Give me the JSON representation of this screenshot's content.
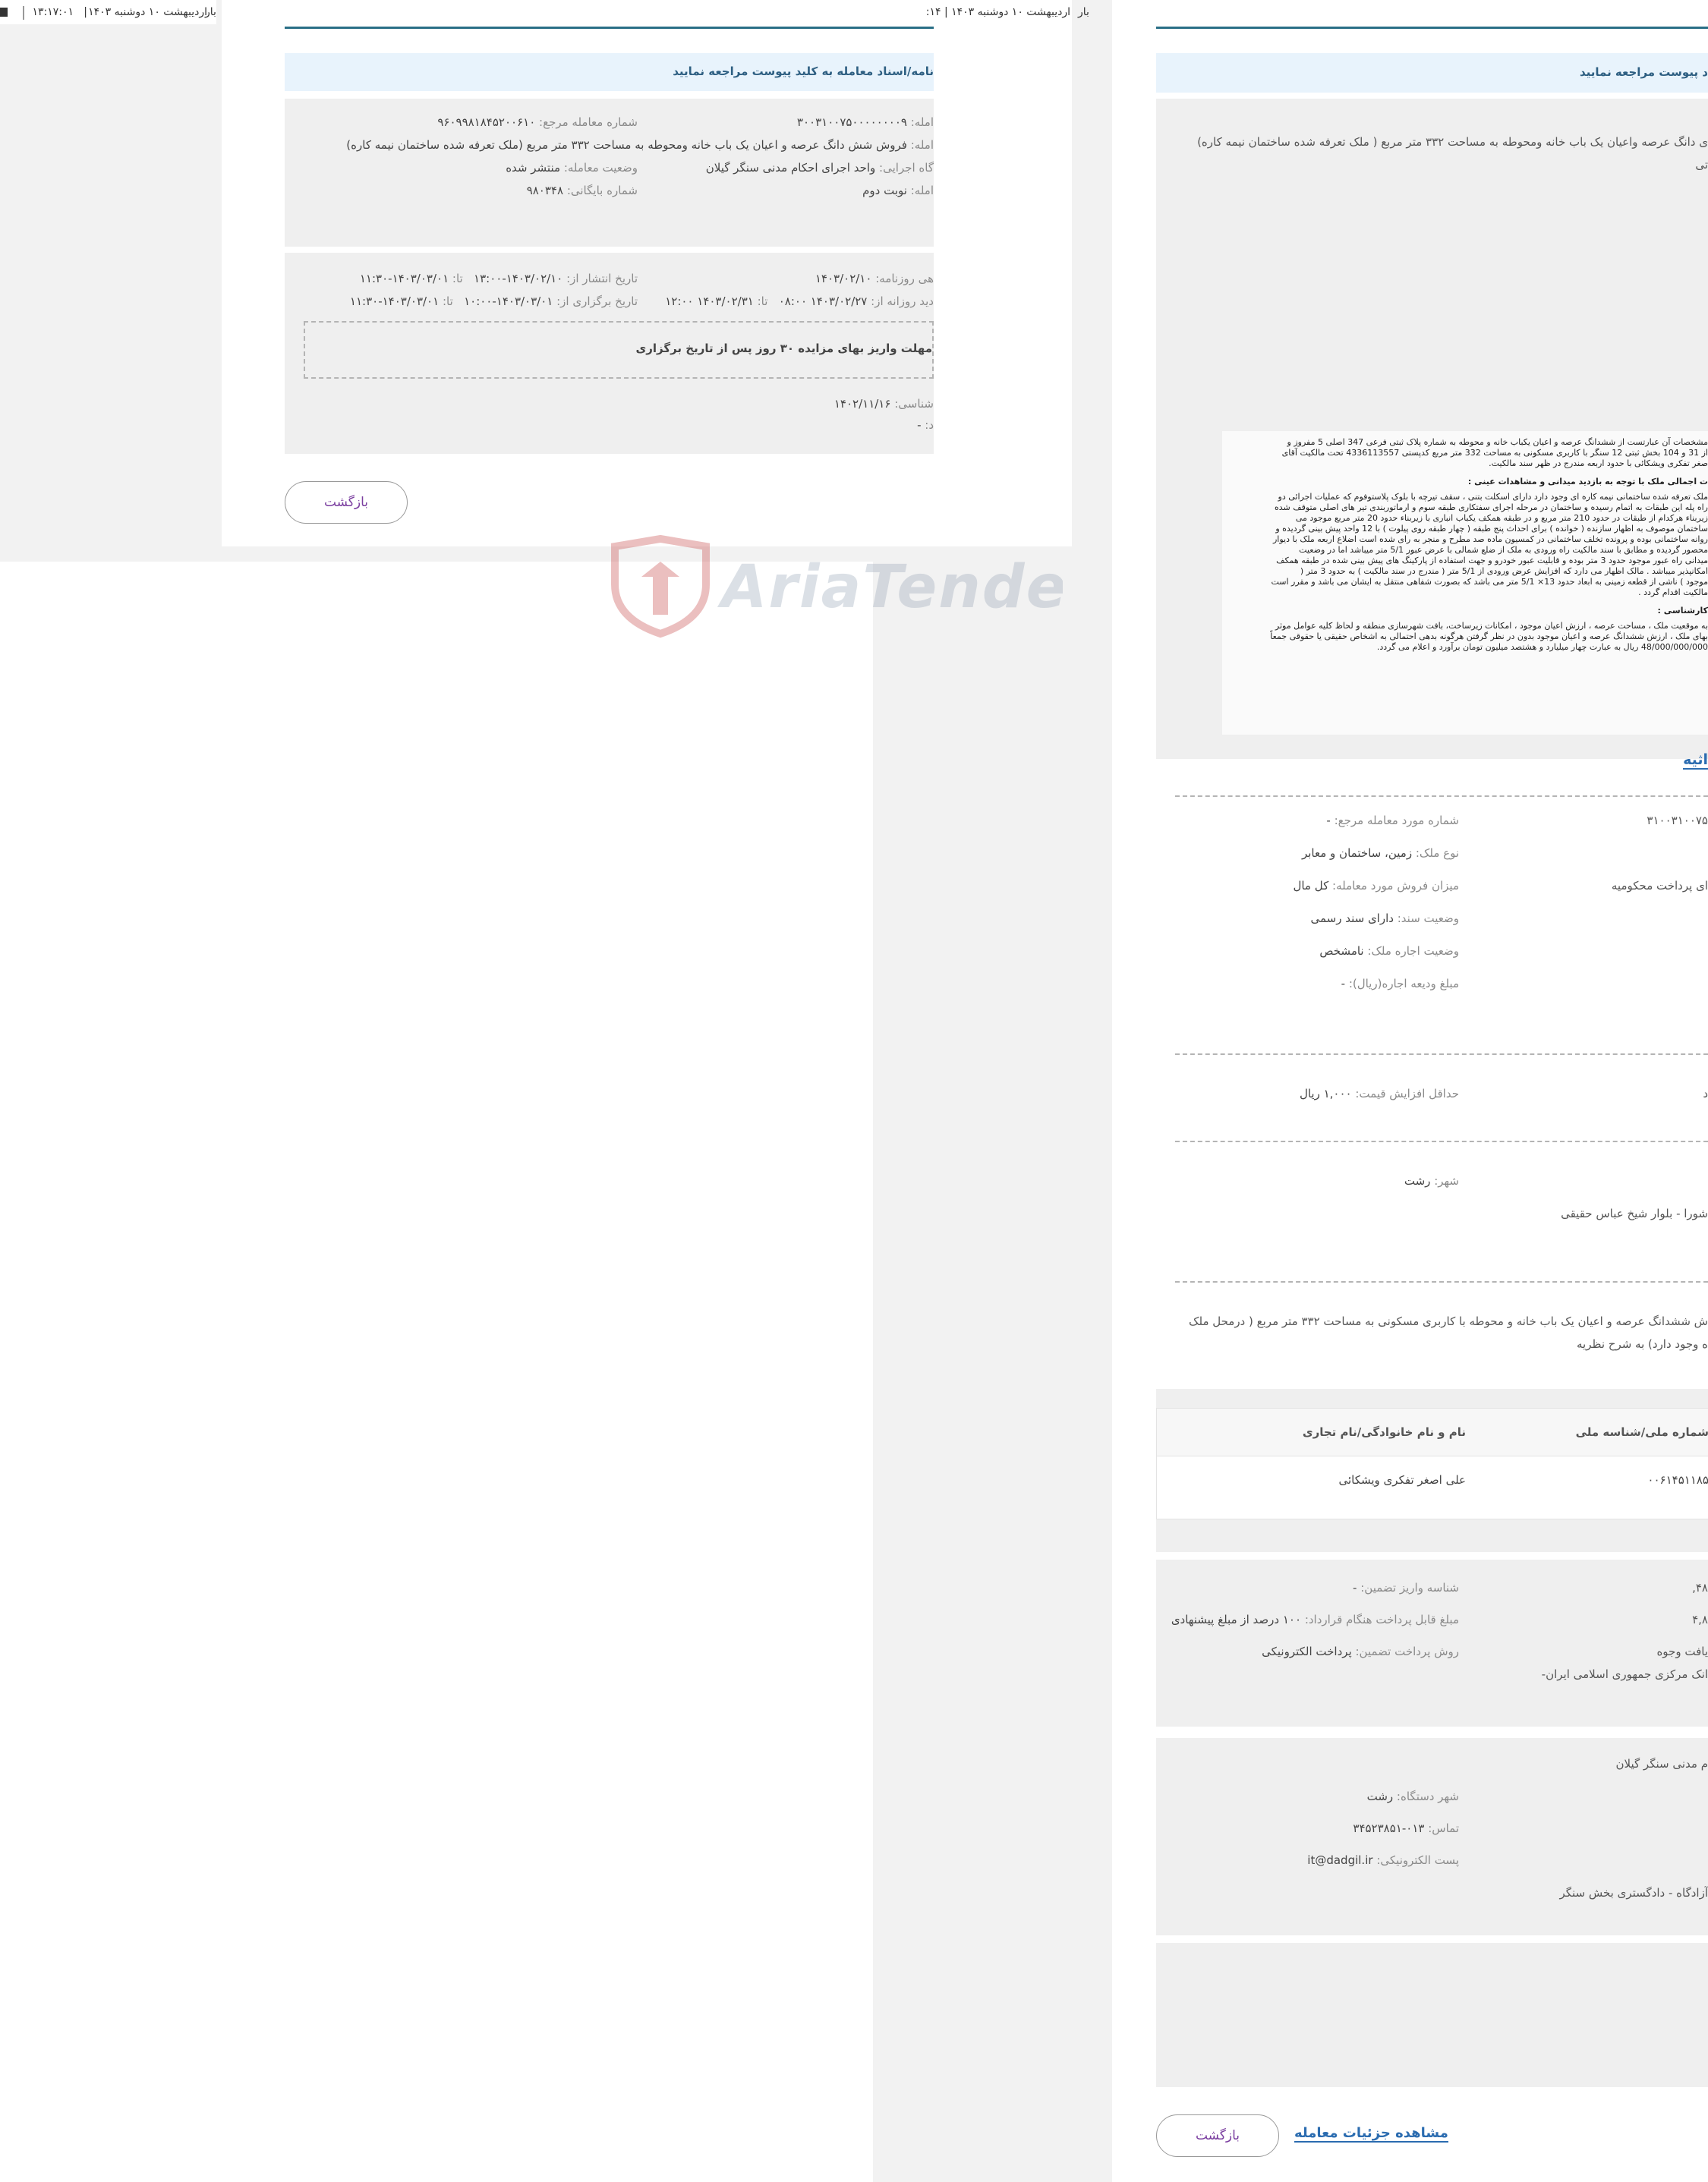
{
  "left_pane": {
    "header": {
      "datetime": "۱۳:۱۷:۰۱",
      "sep": "|",
      "date": "اردیبهشت ۱۰ دوشنبه ۱۴۰۳",
      "cutoff": "بار"
    },
    "header2": {
      "time": "۱۴:",
      "sep": "|",
      "date": "اردیبهشت ۱۰ دوشنبه ۱۴۰۳",
      "cutoff": "بار"
    },
    "info_bar": "نامه/اسناد معامله به کلید پیوست مراجعه نمایید",
    "details": {
      "ref_number_label": "شماره معامله مرجع:",
      "ref_number": "۹۶۰۹۹۸۱۸۴۵۲۰۰۶۱۰",
      "deal_number_label": "امله:",
      "deal_number": "۳۰۰۳۱۰۰۷۵۰۰۰۰۰۰۰۰۹",
      "subject_label": "امله:",
      "subject": "فروش شش دانگ عرصه و اعیان یک باب خانه ومحوطه به مساحت ۳۳۲ متر مربع (ملک تعرفه شده ساختمان نیمه کاره)",
      "status_label": "وضعیت معامله:",
      "status": "منتشر شده",
      "exec_label": "گاه اجرایی:",
      "exec": "واحد اجرای احکام مدنی سنگر گیلان",
      "archive_label": "شماره بایگانی:",
      "archive": "۹۸۰۳۴۸",
      "round_label": "امله:",
      "round": "نوبت دوم"
    },
    "dates": {
      "publish_label": "تاریخ انتشار از:",
      "publish_from": "۱۴۰۳/۰۲/۱۰-۱۳:۰۰",
      "to_label": "تا:",
      "publish_to": "۱۴۰۳/۰۳/۰۱-۱۱:۳۰",
      "newspaper_label": "هی روزنامه:",
      "newspaper": "۱۴۰۳/۰۲/۱۰",
      "holding_label": "تاریخ برگزاری از:",
      "holding_from": "۱۴۰۳/۰۳/۰۱-۱۰:۰۰",
      "holding_to": "۱۴۰۳/۰۳/۰۱-۱۱:۳۰",
      "visit_label": "دید روزانه از:",
      "visit_from": "۱۴۰۳/۰۲/۲۷ ۰۸:۰۰",
      "visit_to": "۱۴۰۳/۰۲/۳۱ ۱۲:۰۰",
      "notice": "مهلت واریز بهای مزایده ۳۰ روز پس از تاریخ برگزاری",
      "expert_label": "شناسی:",
      "expert_date": "۱۴۰۲/۱۱/۱۶",
      "extra_label": "د:",
      "extra": "-"
    },
    "back_button": "بازگشت"
  },
  "right_pane": {
    "info_bar": "د پیوست مراجعه نمایید",
    "subject_line1": "ی دانگ عرصه واعیان یک باب خانه ومحوطه به مساحت ۳۳۲ متر مربع ( ملک تعرفه شده ساختمان نیمه کاره)",
    "subject_line2": "تی",
    "doc": {
      "p1": "مشخصات آن عبارتست از ششدانگ عرصه و اعیان یکباب خانه و محوطه به شماره پلاک ثبتی فرعی 347 اصلی 5 مفروز و",
      "p2": "از 31 و 104 بخش ثبتی 12 سنگر با کاربری مسکونی به مساحت 332 متر مربع کدپستی 4336113557 تحت مالکیت آقای",
      "p3": "صغر تفکری ویشکائی با حدود اربعه مندرج در ظهر سند مالکیت.",
      "h1": "ت اجمالی ملک با توجه به بازدید میدانی و مشاهدات عینی :",
      "p4": "ملک تعرفه شده ساختمانی نیمه کاره ای وجود دارد دارای اسکلت بتنی ، سقف تیرچه با بلوک پلاستوفوم که عملیات اجرائی دو",
      "p5": "راه پله این طبقات به اتمام رسیده و ساختمان در مرحله اجرای سفتکاری طبقه سوم و ارماتوربندی تیر های اصلی متوقف شده",
      "p6": "زیربناء هرکدام از طبقات در حدود 210 متر مربع و در طبقه همکف یکباب انباری با زیربناء حدود 20 متر مربع موجود می",
      "p7": "ساختمان موصوف به اظهار سازنده ( خوانده ) برای احداث پنج طبقه ( چهار طبقه روی پیلوت ) با 12 واحد پیش بینی گردیده و",
      "p8": "روانه ساختمانی بوده و پرونده تخلف ساختمانی در کمسیون ماده صد مطرح و منجر به رای شده است اضلاع اربعه ملک با دیوار",
      "p9": "محصور گردیده و مطابق با سند مالکیت راه ورودی به ملک از ضلع شمالی با عرض عبور 5/1 متر میباشد اما در وضعیت",
      "p10": "میدانی راه عبور موجود حدود 3 متر بوده و قابلیت عبور خودرو و جهت استفاده از پارکینگ های پیش بینی شده در طبقه همکف",
      "p11": "امکانپذیر میباشد . مالک اظهار می دارد که افزایش عرض ورودی از 5/1 متر ( مندرج در سند مالکیت ) به حدود 3 متر (",
      "p12": "موجود ) ناشی از قطعه زمینی به ابعاد حدود 13× 5/1 متر می باشد که بصورت شفاهی منتقل به ایشان می باشد و مقرر است",
      "p13": "مالکیت اقدام گردد .",
      "h2": "کارشناسی :",
      "p14": "به موقعیت ملک ، مساحت عرصه ، ارزش اعیان موجود ، امکانات زیرساخت، بافت شهرسازی منطقه و لحاظ کلیه عوامل موثر",
      "p15": "بهای ملک ، ارزش ششدانگ عرصه و اعیان موجود بدون در نظر گرفتن هرگونه بدهی احتمالی به اشخاص حقیقی یا حقوقی جمعاً",
      "p16": "48/000/000/000 ریال به عبارت چهار میلیارد و هشتصد میلیون تومان برآورد و اعلام می گردد."
    },
    "attachment_link": "اثیه",
    "specs": {
      "ref_deal_label": "شماره مورد معامله مرجع:",
      "ref_deal": "-",
      "deal_num_partial": "۳۱۰۰۳۱۰۰۷۵",
      "property_type_label": "نوع ملک:",
      "property_type": "زمین، ساختمان و معابر",
      "sale_share_label": "میزان فروش مورد معامله:",
      "sale_share": "کل مال",
      "payment_partial": "ای پرداخت محکومیه",
      "deed_label": "وضعیت سند:",
      "deed": "دارای سند رسمی",
      "lease_label": "وضعیت اجاره ملک:",
      "lease": "نامشخص",
      "deposit_label": "مبلغ ودیعه اجاره(ریال):",
      "deposit": "-"
    },
    "price": {
      "min_increase_label": "حداقل افزایش قیمت:",
      "min_increase": "۱,۰۰۰ ریال",
      "partial": "د"
    },
    "location": {
      "city_label": "شهر:",
      "city": "رشت",
      "address_partial": "شورا - بلوار شیخ عباس حقیقی"
    },
    "description": {
      "line1": "ش ششدانگ عرصه و اعیان یک باب خانه و محوطه با کاربری مسکونی به مساحت ۳۳۲ متر مربع ( درمحل ملک",
      "line2": "ه وجود دارد) به شرح نظریه"
    },
    "owners": {
      "col_name": "نام و نام خانوادگی/نام تجاری",
      "col_id": "شماره ملی/شناسه ملی",
      "name": "علی اصغر تفکری ویشکائی",
      "id": "۰۰۶۱۴۵۱۱۸۵"
    },
    "payment": {
      "guarantee_id_label": "شناسه واریز تضمین:",
      "guarantee_id": "-",
      "amount_partial": "۴۸,",
      "contract_pay_label": "مبلغ قابل پرداخت هنگام قرارداد:",
      "contract_pay": "۱۰۰ درصد از مبلغ پیشنهادی",
      "amount2_partial": "۴,۸",
      "method_label": "روش پرداخت تضمین:",
      "method": "پرداخت الکترونیکی",
      "receive_partial": "یافت وجوه",
      "bank_partial": "انک مرکزی جمهوری اسلامی ایران-"
    },
    "organization": {
      "name_partial": "م مدنی سنگر گیلان",
      "city_label": "شهر دستگاه:",
      "city": "رشت",
      "phone_label": "تماس:",
      "phone": "۰۱۳-۳۴۵۲۳۸۵۱",
      "email_label": "پست الکترونیکی:",
      "email": "it@dadgil.ir",
      "address_partial": "آزادگاه - دادگستری بخش سنگر"
    },
    "view_details_link": "مشاهده جزئیات معامله",
    "back_button": "بازگشت"
  },
  "watermark": "AriaTender.neT",
  "colors": {
    "accent": "#2a6f86",
    "info_bg": "#e8f3fc",
    "link": "#2b6cb0",
    "button_text": "#7b3fa0",
    "watermark": "#c84a4a"
  }
}
